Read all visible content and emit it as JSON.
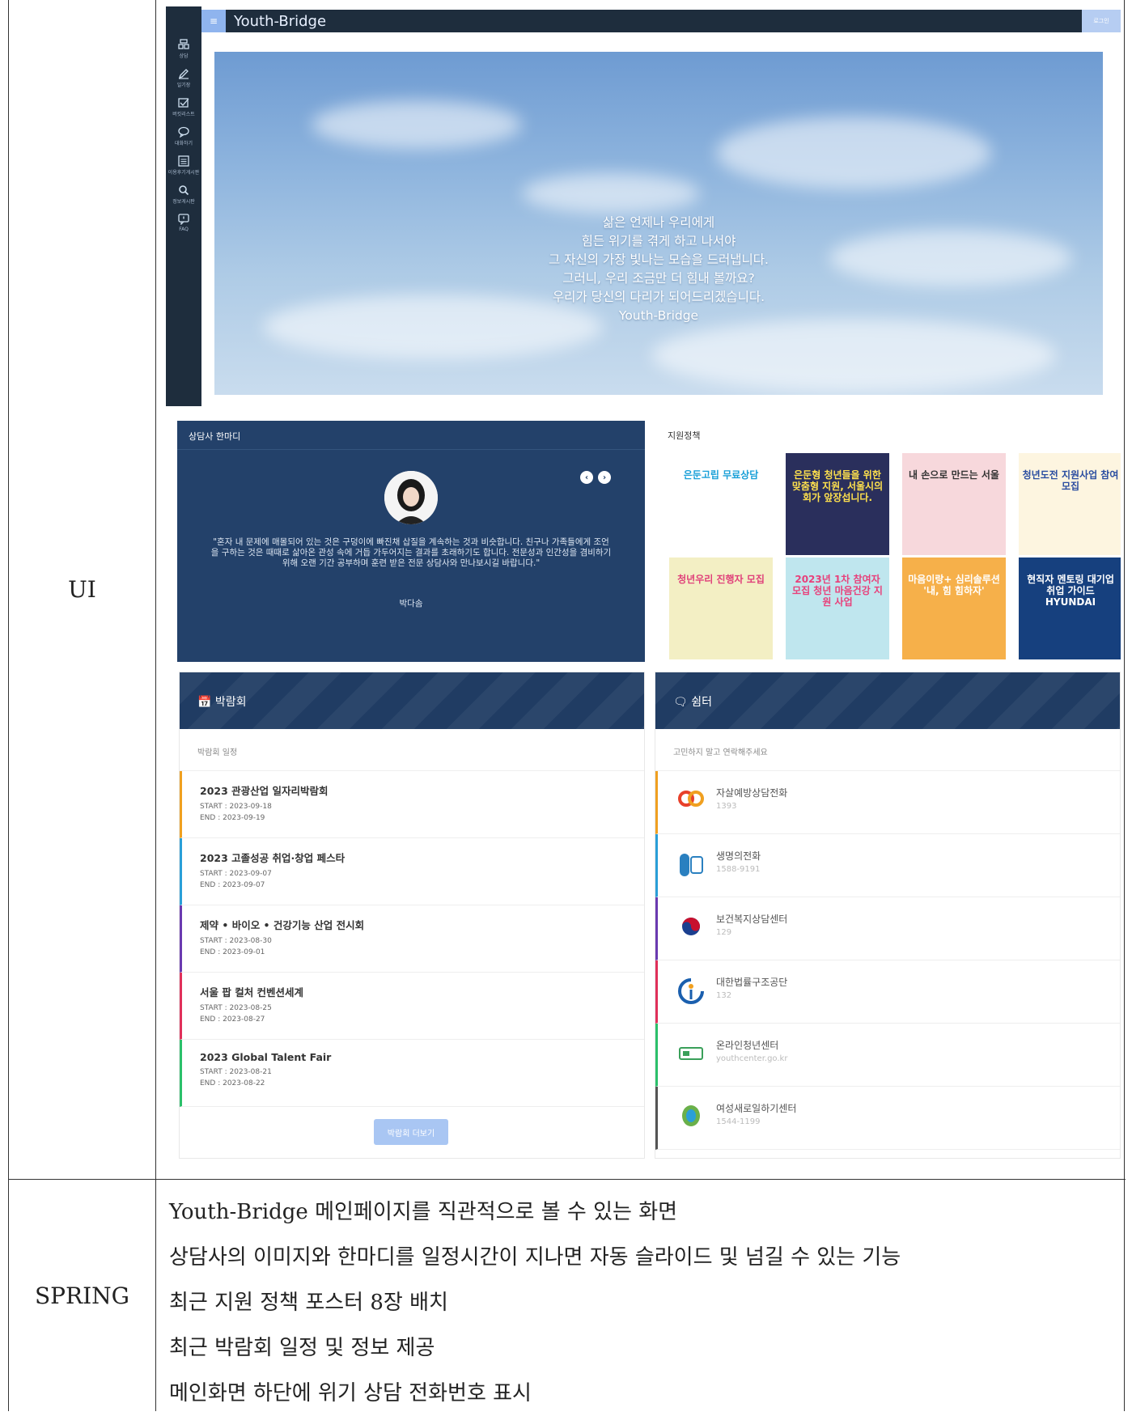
{
  "table": {
    "ui_label": "UI",
    "spring_label": "SPRING"
  },
  "app": {
    "brand": "Youth-Bridge",
    "menu_icon": "≡",
    "login_label": "로그인"
  },
  "sidebar": {
    "items": [
      {
        "label": "상담",
        "icon": "counsel-icon"
      },
      {
        "label": "일기장",
        "icon": "pencil-icon"
      },
      {
        "label": "버킷리스트",
        "icon": "checkbox-icon"
      },
      {
        "label": "대화하기",
        "icon": "chat-icon"
      },
      {
        "label": "이용후기게시판",
        "icon": "list-icon"
      },
      {
        "label": "정보게시판",
        "icon": "search-icon"
      },
      {
        "label": "FAQ",
        "icon": "faq-icon"
      }
    ]
  },
  "hero": {
    "lines": [
      "삶은 언제나 우리에게",
      "힘든 위기를 겪게 하고 나서야",
      "그 자신의 가장 빛나는 모습을 드러냅니다.",
      "그러니, 우리 조금만 더 힘내 볼까요?",
      "우리가 당신의 다리가 되어드리겠습니다.",
      "Youth-Bridge"
    ]
  },
  "counselor": {
    "title": "상담사 한마디",
    "prev": "‹",
    "next": "›",
    "quote": "\"혼자 내 문제에 매몰되어 있는 것은 구덩이에 빠진채 삽질을 계속하는 것과 비슷합니다. 친구나 가족들에게 조언을 구하는 것은 때때로 삶아온 관성 속에 거듭 가두어지는 결과를 초래하기도 합니다. 전문성과 인간성을 겸비하기 위해 오랜 기간 공부하며 훈련 받은 전문 상담사와 만나보시길 바랍니다.\"",
    "name": "박다솜"
  },
  "policy": {
    "title": "지원정책",
    "posters": [
      {
        "text": "은둔고립 무료상담",
        "bg": "#ffffff",
        "fg": "#1aa0d8"
      },
      {
        "text": "은둔형 청년들을 위한 맞춤형 지원, 서울시의회가 앞장섭니다.",
        "bg": "#2a2f5c",
        "fg": "#ffe14d"
      },
      {
        "text": "내 손으로 만드는 서울",
        "bg": "#f7d8dc",
        "fg": "#333333"
      },
      {
        "text": "청년도전 지원사업 참여 모집",
        "bg": "#fdf5e0",
        "fg": "#2a4da0"
      },
      {
        "text": "청년우리 진행자 모집",
        "bg": "#f3efc4",
        "fg": "#e0407a"
      },
      {
        "text": "2023년 1차 참여자 모집 청년 마음건강 지원 사업",
        "bg": "#bfe6ee",
        "fg": "#e8407a"
      },
      {
        "text": "마음이랑+ 심리솔루션 '내, 힘 힘하자'",
        "bg": "#f6b04a",
        "fg": "#ffffff"
      },
      {
        "text": "현직자 멘토링 대기업 취업 가이드 HYUNDAI",
        "bg": "#16407e",
        "fg": "#ffffff"
      }
    ]
  },
  "expo": {
    "title": "박람회",
    "subtitle": "박람회 일정",
    "more_label": "박람회 더보기",
    "items": [
      {
        "title": "2023 관광산업 일자리박람회",
        "start": "START : 2023-09-18",
        "end": "END : 2023-09-19",
        "color": "#f0a020"
      },
      {
        "title": "2023 고졸성공 취업·창업 페스타",
        "start": "START : 2023-09-07",
        "end": "END : 2023-09-07",
        "color": "#2a9fd8"
      },
      {
        "title": "제약 • 바이오 • 건강기능 산업 전시회",
        "start": "START : 2023-08-30",
        "end": "END : 2023-09-01",
        "color": "#6a3ab0"
      },
      {
        "title": "서울 팝 컬처 컨벤션세계",
        "start": "START : 2023-08-25",
        "end": "END : 2023-08-27",
        "color": "#e0305a"
      },
      {
        "title": "2023 Global Talent Fair",
        "start": "START : 2023-08-21",
        "end": "END : 2023-08-22",
        "color": "#2bc06a"
      }
    ]
  },
  "shelter": {
    "title": "쉼터",
    "subtitle": "고민하지 말고 연락해주세요",
    "items": [
      {
        "name": "자살예방상담전화",
        "number": "1393",
        "color": "#f0a020",
        "logo_color": "#e8402a"
      },
      {
        "name": "생명의전화",
        "number": "1588-9191",
        "color": "#2a9fd8",
        "logo_color": "#2a80c0"
      },
      {
        "name": "보건복지상담센터",
        "number": "129",
        "color": "#6a3ab0",
        "logo_color": "#c8102e"
      },
      {
        "name": "대한법률구조공단",
        "number": "132",
        "color": "#e0305a",
        "logo_color": "#1a5fae"
      },
      {
        "name": "온라인청년센터",
        "number": "youthcenter.go.kr",
        "color": "#2bc06a",
        "logo_color": "#3aa05a"
      },
      {
        "name": "여성새로일하기센터",
        "number": "1544-1199",
        "color": "#555555",
        "logo_color": "#6ab04a"
      }
    ]
  },
  "spring": {
    "lines": [
      "Youth-Bridge 메인페이지를 직관적으로 볼 수 있는 화면",
      "상담사의 이미지와 한마디를 일정시간이 지나면 자동 슬라이드 및 넘길 수 있는 기능",
      "최근 지원 정책 포스터 8장 배치",
      "최근 박람회 일정 및 정보 제공",
      "메인화면 하단에 위기 상담 전화번호 표시"
    ]
  }
}
